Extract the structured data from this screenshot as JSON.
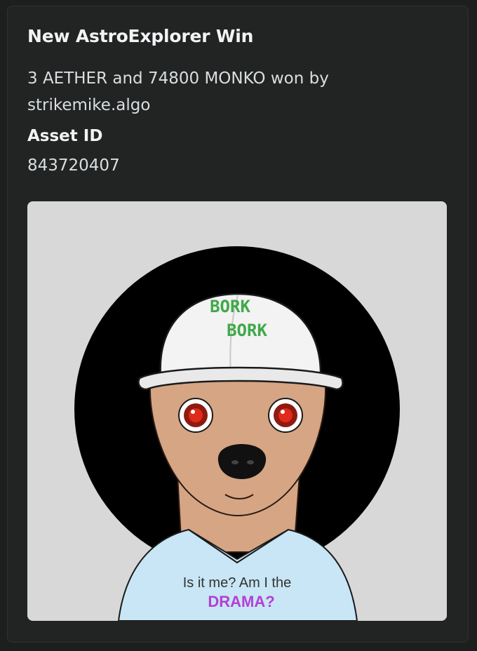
{
  "embed": {
    "title": "New AstroExplorer Win",
    "description": "3 AETHER and 74800 MONKO won by strikemike.algo",
    "fields": [
      {
        "name": "Asset ID",
        "value": "843720407"
      }
    ],
    "image": {
      "hat_text_line1": "BORK",
      "hat_text_line2": "BORK",
      "shirt_text_line1": "Is it me? Am I the",
      "shirt_text_line2": "DRAMA?",
      "background_color": "#d8d8d8",
      "hat_text_color": "#3fa94a",
      "shirt_color": "#c8e6f5",
      "drama_color": "#b33fd6"
    }
  }
}
